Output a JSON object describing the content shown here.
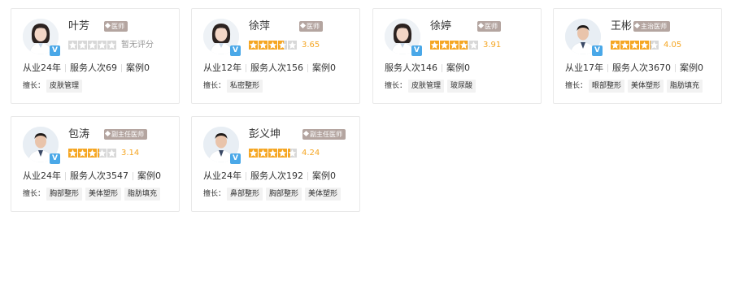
{
  "skills_label": "擅长：",
  "v_label": "V",
  "colors": {
    "star_on": "#f5a623",
    "star_off": "#d8d8d8",
    "title_tag_bg": "#b4a5a0",
    "v_badge": "#4aa8e8"
  },
  "doctors": [
    {
      "name": "叶芳",
      "title": "医师",
      "rating": 0,
      "score_text": "暂无评分",
      "stats": [
        "从业24年",
        "服务人次69",
        "案例0"
      ],
      "skills": [
        "皮肤管理"
      ],
      "avatar": "female-doctor"
    },
    {
      "name": "徐萍",
      "title": "医师",
      "rating": 3.65,
      "score_text": "3.65",
      "stats": [
        "从业12年",
        "服务人次156",
        "案例0"
      ],
      "skills": [
        "私密整形"
      ],
      "avatar": "female-doctor"
    },
    {
      "name": "徐婷",
      "title": "医师",
      "rating": 3.91,
      "score_text": "3.91",
      "stats": [
        "服务人次146",
        "案例0"
      ],
      "skills": [
        "皮肤管理",
        "玻尿酸"
      ],
      "avatar": "female-doctor"
    },
    {
      "name": "王彬",
      "title": "主治医师",
      "rating": 4.05,
      "score_text": "4.05",
      "stats": [
        "从业17年",
        "服务人次3670",
        "案例0"
      ],
      "skills": [
        "眼部整形",
        "美体塑形",
        "脂肪填充"
      ],
      "avatar": "male-doctor"
    },
    {
      "name": "包涛",
      "title": "副主任医师",
      "rating": 3.14,
      "score_text": "3.14",
      "stats": [
        "从业24年",
        "服务人次3547",
        "案例0"
      ],
      "skills": [
        "胸部整形",
        "美体塑形",
        "脂肪填充"
      ],
      "avatar": "male-doctor"
    },
    {
      "name": "彭义坤",
      "title": "副主任医师",
      "rating": 4.24,
      "score_text": "4.24",
      "stats": [
        "从业24年",
        "服务人次192",
        "案例0"
      ],
      "skills": [
        "鼻部整形",
        "胸部整形",
        "美体塑形"
      ],
      "avatar": "male-doctor"
    }
  ]
}
